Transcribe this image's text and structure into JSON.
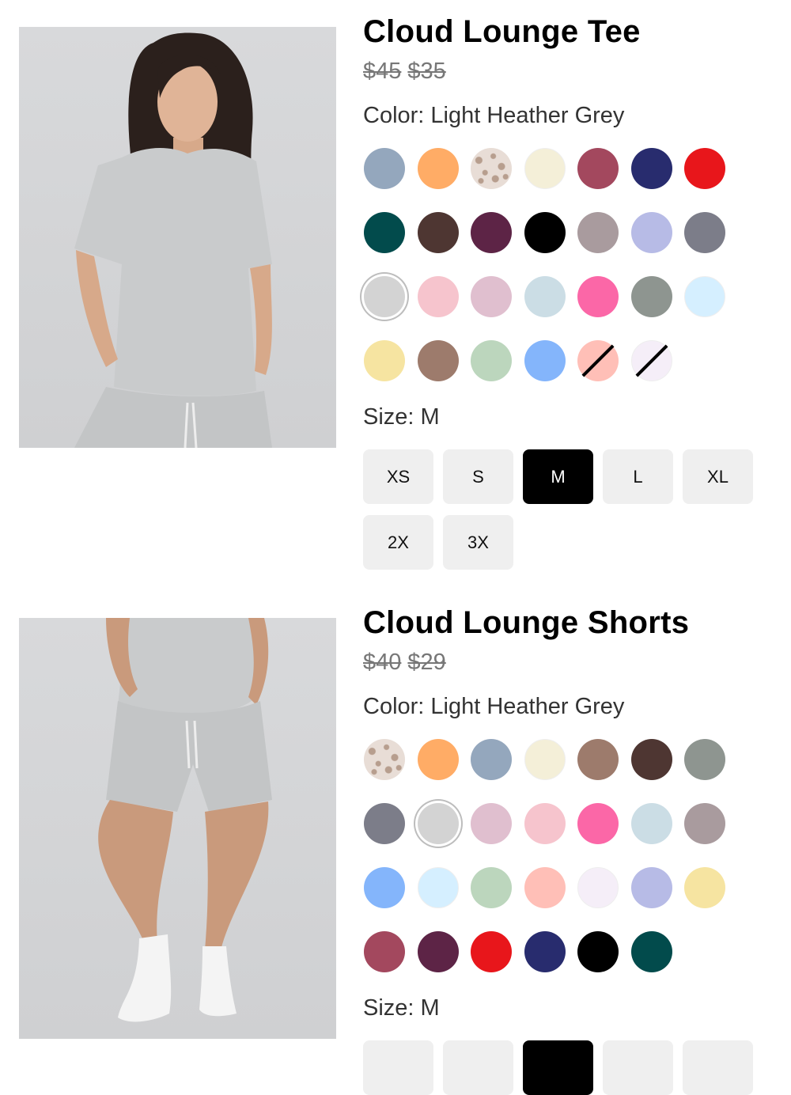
{
  "products": [
    {
      "title": "Cloud Lounge Tee",
      "price_original": "$45",
      "price_sale": "$35",
      "color_label": "Color: Light Heather Grey",
      "size_label": "Size: M",
      "image": "woman-in-grey-tee-photo",
      "swatches": [
        {
          "color": "#94a7bd"
        },
        {
          "color": "#ffac66"
        },
        {
          "color": "leopard"
        },
        {
          "color": "#f4efd8"
        },
        {
          "color": "#a3485e"
        },
        {
          "color": "#282c6e"
        },
        {
          "color": "#e8161b"
        },
        {
          "color": "#024b4c"
        },
        {
          "color": "#4e3632"
        },
        {
          "color": "#5d2446"
        },
        {
          "color": "#000000"
        },
        {
          "color": "#a99b9e"
        },
        {
          "color": "#b7bbe6"
        },
        {
          "color": "#7c7d89"
        },
        {
          "color": "#d3d3d3",
          "selected": true
        },
        {
          "color": "#f6c4cd"
        },
        {
          "color": "#e0bfcf"
        },
        {
          "color": "#cbdde5"
        },
        {
          "color": "#fb67a7"
        },
        {
          "color": "#8e9590"
        },
        {
          "color": "#d5efff"
        },
        {
          "color": "#f6e4a1"
        },
        {
          "color": "#9d7b6c"
        },
        {
          "color": "#bcd6bd"
        },
        {
          "color": "#84b5fb"
        },
        {
          "color": "#ffbfb7",
          "soldout": true
        },
        {
          "color": "#f5eef8",
          "soldout": true
        }
      ],
      "sizes": [
        {
          "label": "XS"
        },
        {
          "label": "S"
        },
        {
          "label": "M",
          "active": true
        },
        {
          "label": "L"
        },
        {
          "label": "XL"
        },
        {
          "label": "2X"
        },
        {
          "label": "3X"
        }
      ]
    },
    {
      "title": "Cloud Lounge Shorts",
      "price_original": "$40",
      "price_sale": "$29",
      "color_label": "Color: Light Heather Grey",
      "size_label": "Size: M",
      "image": "woman-in-grey-shorts-photo",
      "swatches": [
        {
          "color": "leopard"
        },
        {
          "color": "#ffac66"
        },
        {
          "color": "#94a7bd"
        },
        {
          "color": "#f4efd8"
        },
        {
          "color": "#9d7b6c"
        },
        {
          "color": "#4e3632"
        },
        {
          "color": "#8e9590"
        },
        {
          "color": "#7c7d89"
        },
        {
          "color": "#d3d3d3",
          "selected": true
        },
        {
          "color": "#e0bfcf"
        },
        {
          "color": "#f6c4cd"
        },
        {
          "color": "#fb67a7"
        },
        {
          "color": "#cbdde5"
        },
        {
          "color": "#a99b9e"
        },
        {
          "color": "#84b5fb"
        },
        {
          "color": "#d5efff"
        },
        {
          "color": "#bcd6bd"
        },
        {
          "color": "#ffbfb7"
        },
        {
          "color": "#f5eef8"
        },
        {
          "color": "#b7bbe6"
        },
        {
          "color": "#f6e4a1"
        },
        {
          "color": "#a3485e"
        },
        {
          "color": "#5d2446"
        },
        {
          "color": "#e8161b"
        },
        {
          "color": "#282c6e"
        },
        {
          "color": "#000000"
        },
        {
          "color": "#024b4c"
        }
      ],
      "sizes": [
        {
          "label": ""
        },
        {
          "label": ""
        },
        {
          "label": "",
          "active": true
        },
        {
          "label": ""
        },
        {
          "label": ""
        }
      ]
    }
  ]
}
